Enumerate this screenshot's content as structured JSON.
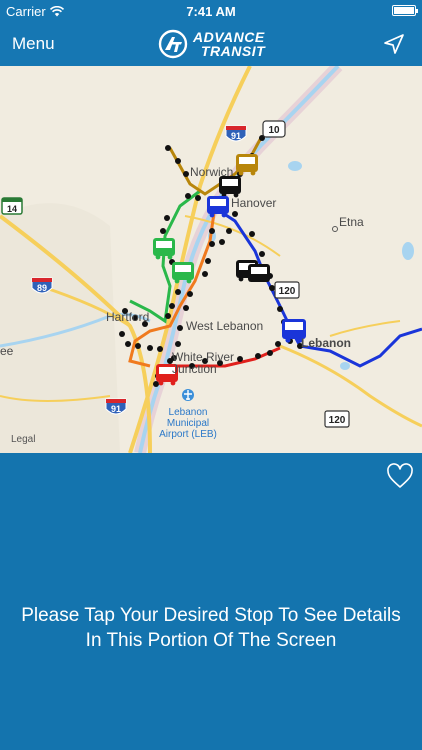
{
  "status_bar": {
    "carrier": "Carrier",
    "time": "7:41 AM",
    "battery_level": 1.0
  },
  "nav": {
    "menu_label": "Menu",
    "logo_line1": "ADVANCE",
    "logo_line2": "TRANSIT",
    "location_icon": "location-arrow-icon"
  },
  "map": {
    "places": {
      "norwich": "Norwich",
      "hanover": "Hanover",
      "etna": "Etna",
      "west_lebanon": "West Lebanon",
      "lebanon": "Lebanon",
      "hartford": "Hartford",
      "white_river": "White River",
      "junction": "Junction",
      "airport_line1": "Lebanon",
      "airport_line2": "Municipal",
      "airport_line3": "Airport (LEB)",
      "partial_left": "ee"
    },
    "shields": {
      "i91_top": "91",
      "us10": "10",
      "i89": "89",
      "vt14": "14",
      "nh120_a": "120",
      "nh120_b": "120",
      "i91_bottom": "91"
    },
    "legal": "Legal",
    "route_colors": {
      "blue": "#1a35d9",
      "green": "#2ab84a",
      "orange": "#f07a1e",
      "red": "#e0201c",
      "gold": "#b8860b",
      "black": "#111111"
    }
  },
  "panel": {
    "favorite_icon": "heart-outline-icon",
    "message_line1": "Please Tap Your Desired Stop To See Details",
    "message_line2": "In This Portion Of The Screen"
  }
}
